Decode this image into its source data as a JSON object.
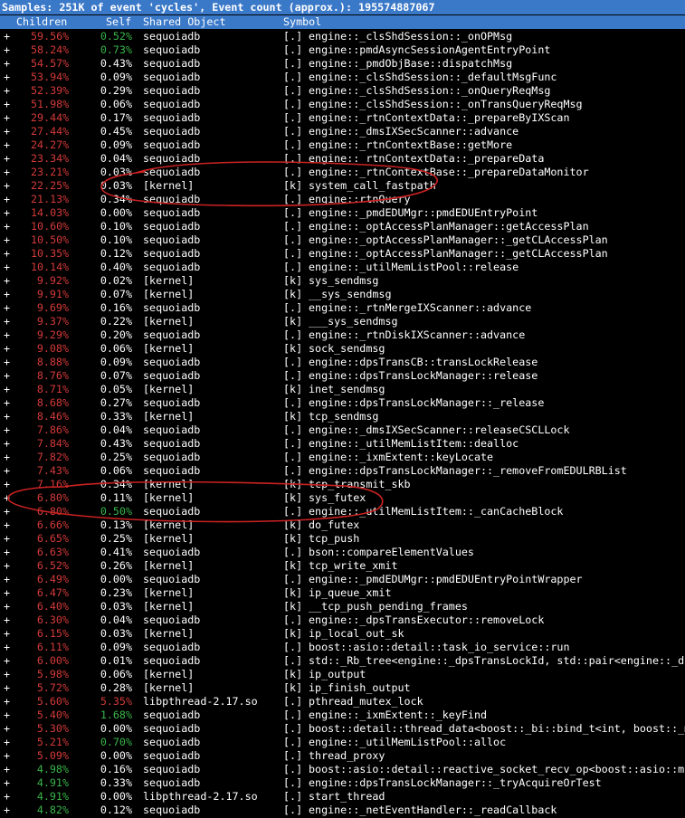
{
  "title": "Samples: 251K of event 'cycles', Event count (approx.): 195574887067",
  "columns": {
    "children": "Children",
    "self": "Self",
    "object": "Shared Object",
    "symbol": "Symbol"
  },
  "colors": {
    "header_bg": "#3a78c8",
    "red": "#d43a3a",
    "green": "#39b54a",
    "text": "#ffffff",
    "annotation": "#cc2222"
  },
  "rows": [
    [
      "+",
      "59.56%",
      "0.52%",
      "sequoiadb",
      "[.]",
      "engine::_clsShdSession::_onOPMsg",
      "red",
      "green"
    ],
    [
      "+",
      "58.24%",
      "0.73%",
      "sequoiadb",
      "[.]",
      "engine::pmdAsyncSessionAgentEntryPoint",
      "red",
      "green"
    ],
    [
      "+",
      "54.57%",
      "0.43%",
      "sequoiadb",
      "[.]",
      "engine::_pmdObjBase::dispatchMsg",
      "red",
      "white"
    ],
    [
      "+",
      "53.94%",
      "0.09%",
      "sequoiadb",
      "[.]",
      "engine::_clsShdSession::_defaultMsgFunc",
      "red",
      "white"
    ],
    [
      "+",
      "52.39%",
      "0.29%",
      "sequoiadb",
      "[.]",
      "engine::_clsShdSession::_onQueryReqMsg",
      "red",
      "white"
    ],
    [
      "+",
      "51.98%",
      "0.06%",
      "sequoiadb",
      "[.]",
      "engine::_clsShdSession::_onTransQueryReqMsg",
      "red",
      "white"
    ],
    [
      "+",
      "29.44%",
      "0.17%",
      "sequoiadb",
      "[.]",
      "engine::_rtnContextData::_prepareByIXScan",
      "red",
      "white"
    ],
    [
      "+",
      "27.44%",
      "0.45%",
      "sequoiadb",
      "[.]",
      "engine::_dmsIXSecScanner::advance",
      "red",
      "white"
    ],
    [
      "+",
      "24.27%",
      "0.09%",
      "sequoiadb",
      "[.]",
      "engine::_rtnContextBase::getMore",
      "red",
      "white"
    ],
    [
      "+",
      "23.34%",
      "0.04%",
      "sequoiadb",
      "[.]",
      "engine::_rtnContextData::_prepareData",
      "red",
      "white"
    ],
    [
      "+",
      "23.21%",
      "0.03%",
      "sequoiadb",
      "[.]",
      "engine::_rtnContextBase::_prepareDataMonitor",
      "red",
      "white"
    ],
    [
      "+",
      "22.25%",
      "0.03%",
      "[kernel]",
      "[k]",
      "system_call_fastpath",
      "red",
      "white"
    ],
    [
      "+",
      "21.13%",
      "0.34%",
      "sequoiadb",
      "[.]",
      "engine::rtnQuery",
      "red",
      "white"
    ],
    [
      "+",
      "14.03%",
      "0.00%",
      "sequoiadb",
      "[.]",
      "engine::_pmdEDUMgr::pmdEDUEntryPoint",
      "red",
      "white"
    ],
    [
      "+",
      "10.60%",
      "0.10%",
      "sequoiadb",
      "[.]",
      "engine::_optAccessPlanManager::getAccessPlan",
      "red",
      "white"
    ],
    [
      "+",
      "10.50%",
      "0.10%",
      "sequoiadb",
      "[.]",
      "engine::_optAccessPlanManager::_getCLAccessPlan",
      "red",
      "white"
    ],
    [
      "+",
      "10.35%",
      "0.12%",
      "sequoiadb",
      "[.]",
      "engine::_optAccessPlanManager::_getCLAccessPlan",
      "red",
      "white"
    ],
    [
      "+",
      "10.14%",
      "0.40%",
      "sequoiadb",
      "[.]",
      "engine::_utilMemListPool::release",
      "red",
      "white"
    ],
    [
      "+",
      "9.92%",
      "0.02%",
      "[kernel]",
      "[k]",
      "sys_sendmsg",
      "red",
      "white"
    ],
    [
      "+",
      "9.91%",
      "0.07%",
      "[kernel]",
      "[k]",
      "__sys_sendmsg",
      "red",
      "white"
    ],
    [
      "+",
      "9.69%",
      "0.16%",
      "sequoiadb",
      "[.]",
      "engine::_rtnMergeIXScanner::advance",
      "red",
      "white"
    ],
    [
      "+",
      "9.37%",
      "0.22%",
      "[kernel]",
      "[k]",
      "___sys_sendmsg",
      "red",
      "white"
    ],
    [
      "+",
      "9.29%",
      "0.20%",
      "sequoiadb",
      "[.]",
      "engine::_rtnDiskIXScanner::advance",
      "red",
      "white"
    ],
    [
      "+",
      "9.08%",
      "0.06%",
      "[kernel]",
      "[k]",
      "sock_sendmsg",
      "red",
      "white"
    ],
    [
      "+",
      "8.88%",
      "0.09%",
      "sequoiadb",
      "[.]",
      "engine::dpsTransCB::transLockRelease",
      "red",
      "white"
    ],
    [
      "+",
      "8.76%",
      "0.07%",
      "sequoiadb",
      "[.]",
      "engine::dpsTransLockManager::release",
      "red",
      "white"
    ],
    [
      "+",
      "8.71%",
      "0.05%",
      "[kernel]",
      "[k]",
      "inet_sendmsg",
      "red",
      "white"
    ],
    [
      "+",
      "8.68%",
      "0.27%",
      "sequoiadb",
      "[.]",
      "engine::dpsTransLockManager::_release",
      "red",
      "white"
    ],
    [
      "+",
      "8.46%",
      "0.33%",
      "[kernel]",
      "[k]",
      "tcp_sendmsg",
      "red",
      "white"
    ],
    [
      "+",
      "7.86%",
      "0.04%",
      "sequoiadb",
      "[.]",
      "engine::_dmsIXSecScanner::releaseCSCLLock",
      "red",
      "white"
    ],
    [
      "+",
      "7.84%",
      "0.43%",
      "sequoiadb",
      "[.]",
      "engine::_utilMemListItem::dealloc",
      "red",
      "white"
    ],
    [
      "+",
      "7.82%",
      "0.25%",
      "sequoiadb",
      "[.]",
      "engine::_ixmExtent::keyLocate",
      "red",
      "white"
    ],
    [
      "+",
      "7.43%",
      "0.06%",
      "sequoiadb",
      "[.]",
      "engine::dpsTransLockManager::_removeFromEDULRBList",
      "red",
      "white"
    ],
    [
      "+",
      "7.16%",
      "0.34%",
      "[kernel]",
      "[k]",
      "tcp_transmit_skb",
      "red",
      "white"
    ],
    [
      "+",
      "6.80%",
      "0.11%",
      "[kernel]",
      "[k]",
      "sys_futex",
      "red",
      "white"
    ],
    [
      "+",
      "6.80%",
      "0.50%",
      "sequoiadb",
      "[.]",
      "engine::_utilMemListItem::_canCacheBlock",
      "red",
      "green"
    ],
    [
      "+",
      "6.66%",
      "0.13%",
      "[kernel]",
      "[k]",
      "do_futex",
      "red",
      "white"
    ],
    [
      "+",
      "6.65%",
      "0.25%",
      "[kernel]",
      "[k]",
      "tcp_push",
      "red",
      "white"
    ],
    [
      "+",
      "6.63%",
      "0.41%",
      "sequoiadb",
      "[.]",
      "bson::compareElementValues",
      "red",
      "white"
    ],
    [
      "+",
      "6.52%",
      "0.26%",
      "[kernel]",
      "[k]",
      "tcp_write_xmit",
      "red",
      "white"
    ],
    [
      "+",
      "6.49%",
      "0.00%",
      "sequoiadb",
      "[.]",
      "engine::_pmdEDUMgr::pmdEDUEntryPointWrapper",
      "red",
      "white"
    ],
    [
      "+",
      "6.47%",
      "0.23%",
      "[kernel]",
      "[k]",
      "ip_queue_xmit",
      "red",
      "white"
    ],
    [
      "+",
      "6.40%",
      "0.03%",
      "[kernel]",
      "[k]",
      "__tcp_push_pending_frames",
      "red",
      "white"
    ],
    [
      "+",
      "6.30%",
      "0.04%",
      "sequoiadb",
      "[.]",
      "engine::_dpsTransExecutor::removeLock",
      "red",
      "white"
    ],
    [
      "+",
      "6.15%",
      "0.03%",
      "[kernel]",
      "[k]",
      "ip_local_out_sk",
      "red",
      "white"
    ],
    [
      "+",
      "6.11%",
      "0.09%",
      "sequoiadb",
      "[.]",
      "boost::asio::detail::task_io_service::run",
      "red",
      "white"
    ],
    [
      "+",
      "6.00%",
      "0.01%",
      "sequoiadb",
      "[.]",
      "std::_Rb_tree<engine::_dpsTransLockId, std::pair<engine::_dp",
      "red",
      "white"
    ],
    [
      "+",
      "5.98%",
      "0.06%",
      "[kernel]",
      "[k]",
      "ip_output",
      "red",
      "white"
    ],
    [
      "+",
      "5.72%",
      "0.28%",
      "[kernel]",
      "[k]",
      "ip_finish_output",
      "red",
      "white"
    ],
    [
      "+",
      "5.60%",
      "5.35%",
      "libpthread-2.17.so",
      "[.]",
      "pthread_mutex_lock",
      "red",
      "red"
    ],
    [
      "+",
      "5.40%",
      "1.68%",
      "sequoiadb",
      "[.]",
      "engine::_ixmExtent::_keyFind",
      "red",
      "green"
    ],
    [
      "+",
      "5.30%",
      "0.00%",
      "sequoiadb",
      "[.]",
      "boost::detail::thread_data<boost::_bi::bind_t<int, boost::_m",
      "red",
      "white"
    ],
    [
      "+",
      "5.21%",
      "0.70%",
      "sequoiadb",
      "[.]",
      "engine::_utilMemListPool::alloc",
      "red",
      "green"
    ],
    [
      "+",
      "5.09%",
      "0.00%",
      "sequoiadb",
      "[.]",
      "thread_proxy",
      "red",
      "white"
    ],
    [
      "+",
      "4.98%",
      "0.16%",
      "sequoiadb",
      "[.]",
      "boost::asio::detail::reactive_socket_recv_op<boost::asio::mu",
      "green",
      "white"
    ],
    [
      "+",
      "4.91%",
      "0.33%",
      "sequoiadb",
      "[.]",
      "engine::dpsTransLockManager::_tryAcquireOrTest",
      "green",
      "white"
    ],
    [
      "+",
      "4.91%",
      "0.00%",
      "libpthread-2.17.so",
      "[.]",
      "start_thread",
      "green",
      "white"
    ],
    [
      "+",
      "4.82%",
      "0.12%",
      "sequoiadb",
      "[.]",
      "engine::_netEventHandler::_readCallback",
      "green",
      "white"
    ]
  ]
}
